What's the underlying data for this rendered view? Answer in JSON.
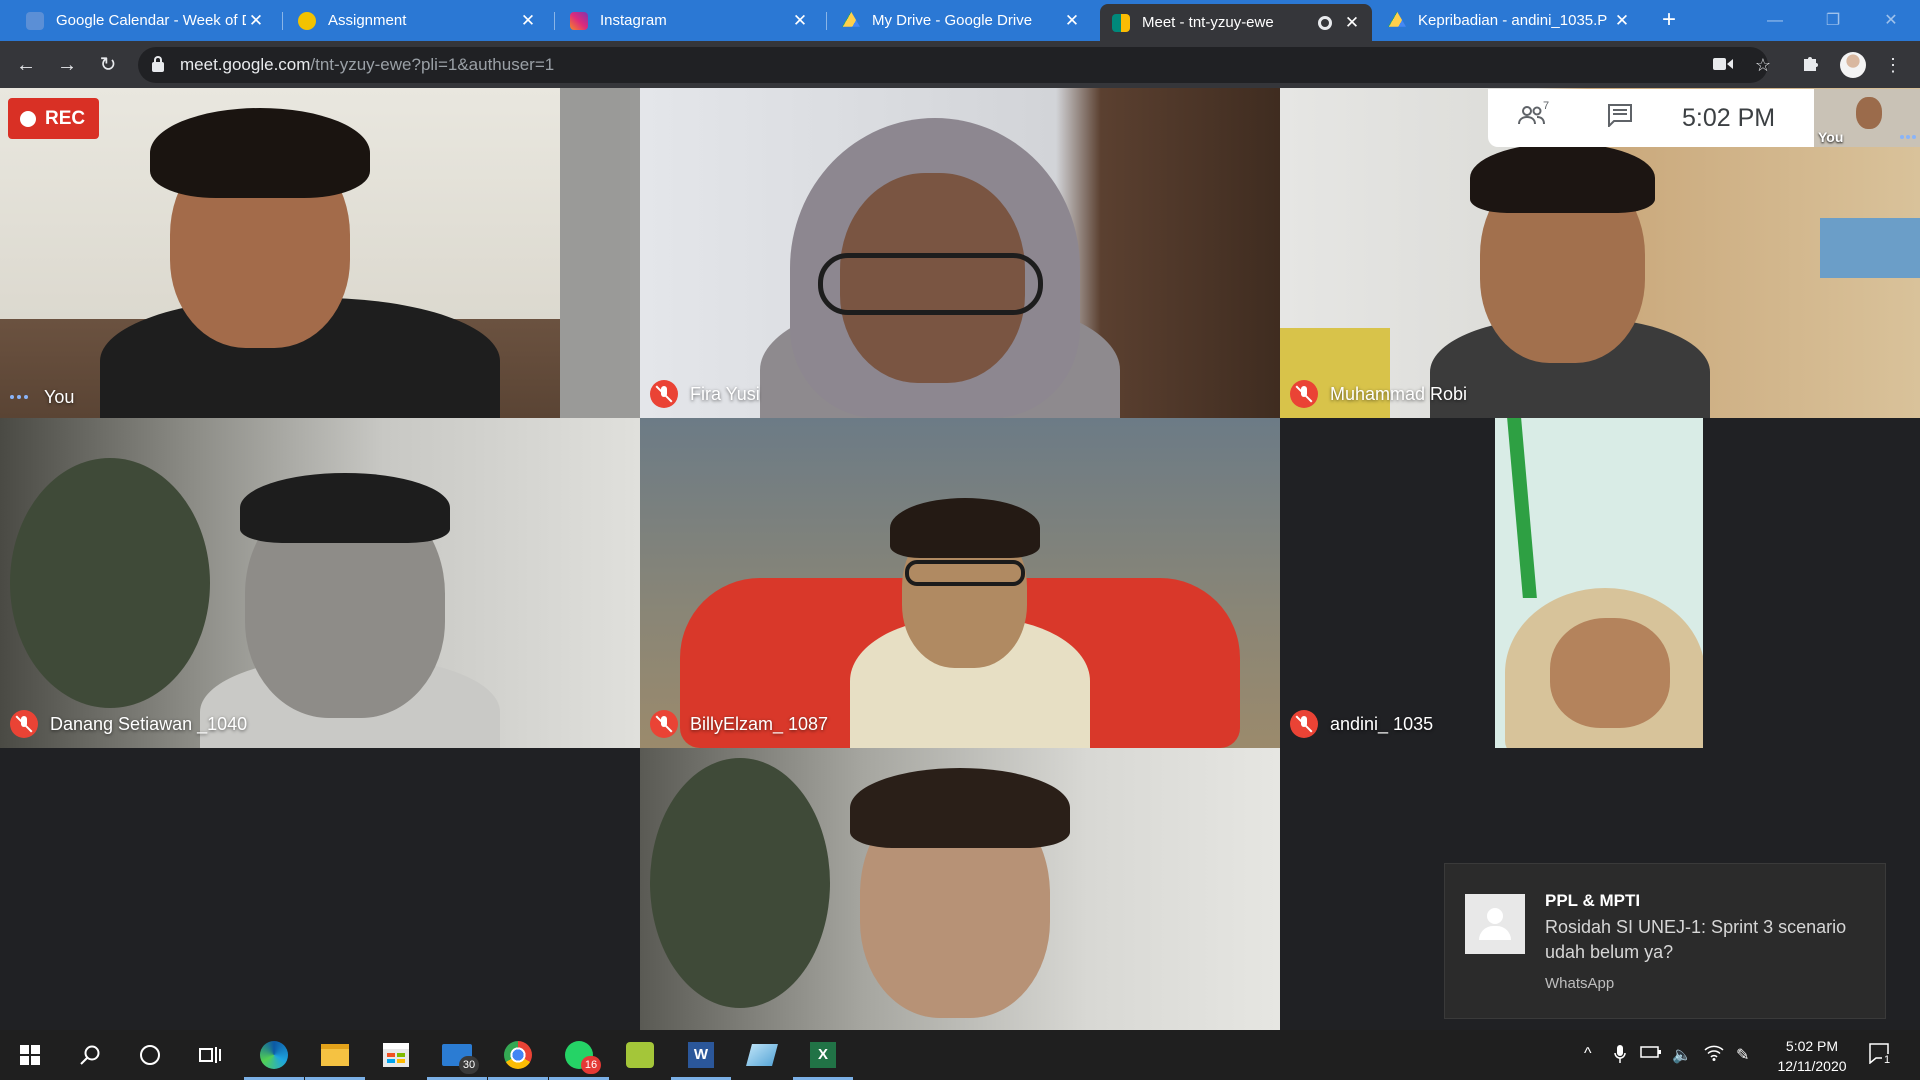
{
  "browser": {
    "tabs": [
      {
        "title": "Google Calendar - Week of D",
        "icon": "google-calendar-icon",
        "color": "#5b8fd6",
        "active": false
      },
      {
        "title": "Assignment",
        "icon": "unej-logo-icon",
        "color": "#f2c200",
        "active": false
      },
      {
        "title": "Instagram",
        "icon": "instagram-icon",
        "color": "#e1306c",
        "active": false
      },
      {
        "title": "My Drive - Google Drive",
        "icon": "google-drive-icon",
        "color": "#1fa463",
        "active": false
      },
      {
        "title": "Meet - tnt-yzuy-ewe",
        "icon": "google-meet-icon",
        "color": "#00897b",
        "active": true
      },
      {
        "title": "Kepribadian - andini_1035.P",
        "icon": "google-drive-icon",
        "color": "#ffd04b",
        "active": false
      }
    ],
    "new_tab": "+",
    "window_controls": {
      "minimize": "—",
      "restore": "❐",
      "close": "✕"
    },
    "url_host": "meet.google.com",
    "url_path": "/tnt-yzuy-ewe?pli=1&authuser=1"
  },
  "meet": {
    "recording_label": "REC",
    "participants_count": "7",
    "time": "5:02  PM",
    "self_view_label": "You",
    "participants": [
      {
        "name": "You",
        "muted": false,
        "speaking": true
      },
      {
        "name": "Fira Yusi",
        "muted": true
      },
      {
        "name": "Muhammad Robi",
        "muted": true
      },
      {
        "name": "Danang Setiawan _1040",
        "muted": true
      },
      {
        "name": "BillyElzam_ 1087",
        "muted": true
      },
      {
        "name": "andini_ 1035",
        "muted": true
      },
      {
        "name": "",
        "muted": false
      }
    ]
  },
  "notification": {
    "title": "PPL & MPTI",
    "body": "Rosidah SI UNEJ-1: Sprint 3 scenario udah belum ya?",
    "app": "WhatsApp"
  },
  "taskbar": {
    "apps": [
      {
        "name": "edge",
        "badge": ""
      },
      {
        "name": "file-explorer",
        "badge": ""
      },
      {
        "name": "store",
        "badge": ""
      },
      {
        "name": "mail",
        "badge": "30"
      },
      {
        "name": "chrome",
        "badge": ""
      },
      {
        "name": "whatsapp",
        "badge": "16"
      },
      {
        "name": "android-studio",
        "badge": ""
      },
      {
        "name": "word",
        "badge": ""
      },
      {
        "name": "paint",
        "badge": ""
      },
      {
        "name": "excel",
        "badge": ""
      }
    ],
    "clock_time": "5:02 PM",
    "clock_date": "12/11/2020",
    "notification_count": "1"
  }
}
